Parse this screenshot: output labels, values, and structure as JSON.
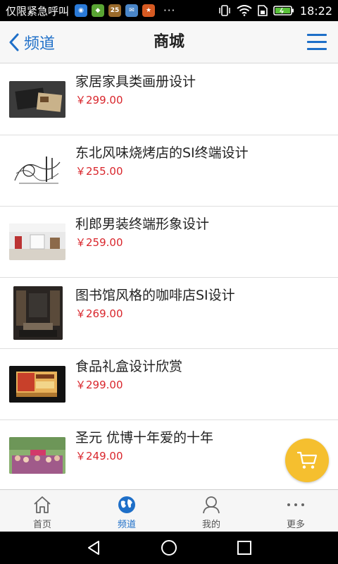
{
  "status_bar": {
    "carrier": "仅限紧急呼叫",
    "app_icons": [
      {
        "name": "qq-icon",
        "color": "#2a7ad8",
        "glyph": "◉"
      },
      {
        "name": "app-icon",
        "color": "#59a533",
        "glyph": "◆"
      },
      {
        "name": "calendar-icon",
        "color": "#9a6a2a",
        "glyph": "25"
      },
      {
        "name": "mail-icon",
        "color": "#4a86c8",
        "glyph": "✉"
      },
      {
        "name": "game-icon",
        "color": "#d65a22",
        "glyph": "★"
      }
    ],
    "overflow": "···",
    "time": "18:22"
  },
  "header": {
    "back_label": "频道",
    "title": "商城"
  },
  "products": [
    {
      "title": "家居家具类画册设计",
      "price": "￥299.00"
    },
    {
      "title": "东北风味烧烤店的SI终端设计",
      "price": "￥255.00"
    },
    {
      "title": "利郎男装终端形象设计",
      "price": "￥259.00"
    },
    {
      "title": "图书馆风格的咖啡店SI设计",
      "price": "￥269.00"
    },
    {
      "title": "食品礼盒设计欣赏",
      "price": "￥299.00"
    },
    {
      "title": "圣元 优博十年爱的十年",
      "price": "￥249.00"
    }
  ],
  "tabs": [
    {
      "label": "首页",
      "icon": "home-icon",
      "active": false
    },
    {
      "label": "频道",
      "icon": "globe-icon",
      "active": true
    },
    {
      "label": "我的",
      "icon": "user-icon",
      "active": false
    },
    {
      "label": "更多",
      "icon": "more-icon",
      "active": false
    }
  ],
  "colors": {
    "accent": "#1e6fc8",
    "price": "#d9262c",
    "cart_fab": "#f5bf2f"
  }
}
